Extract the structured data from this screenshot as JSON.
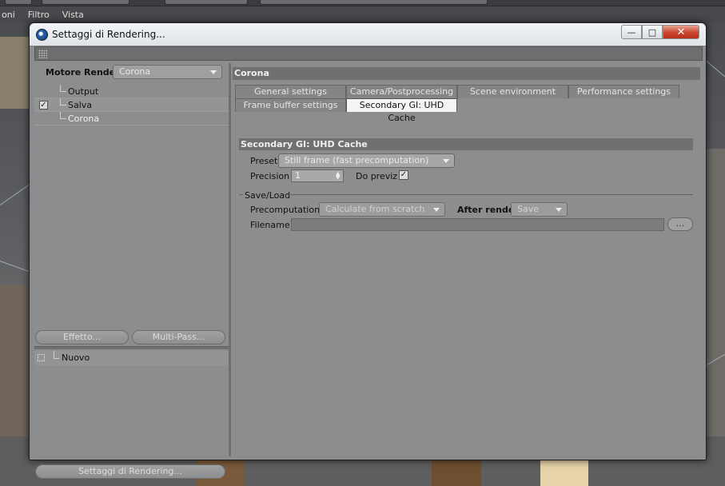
{
  "host_app": {
    "menu": [
      "oni",
      "Filtro",
      "Vista"
    ]
  },
  "dialog": {
    "title": "Settaggi di Rendering...",
    "controls": {
      "minimize": "—",
      "maximize": "□",
      "close": "✕"
    }
  },
  "left_panel": {
    "engine_label": "Motore Render",
    "engine_value": "Corona",
    "items": [
      {
        "label": "Output",
        "checked": false
      },
      {
        "label": "Salva",
        "checked": true
      },
      {
        "label": "Corona",
        "checked": false,
        "selected": true
      }
    ],
    "check_glyph": "✓",
    "effetto_button": "Effetto...",
    "multipass_button": "Multi-Pass...",
    "nuovo_label": "Nuovo",
    "settaggi_button": "Settaggi di Rendering..."
  },
  "right_panel": {
    "section_title": "Corona",
    "tabs_row1": [
      "General settings",
      "Camera/Postprocessing",
      "Scene environment",
      "Performance settings"
    ],
    "tabs_row2": [
      "Frame buffer settings",
      "Secondary GI: UHD Cache"
    ],
    "active_tab": "Secondary GI: UHD Cache",
    "group_title": "Secondary GI: UHD Cache",
    "preset_label": "Preset",
    "preset_value": "Still frame (fast precomputation)",
    "precision_label": "Precision",
    "precision_value": "1",
    "do_previz_label": "Do previz",
    "do_previz_checked": true,
    "saveload_title": "Save/Load",
    "precomputation_label": "Precomputation",
    "precomputation_value": "Calculate from scratch",
    "after_render_label": "After render",
    "after_render_value": "Save",
    "filename_label": "Filename",
    "filename_value": "",
    "browse_label": "..."
  }
}
